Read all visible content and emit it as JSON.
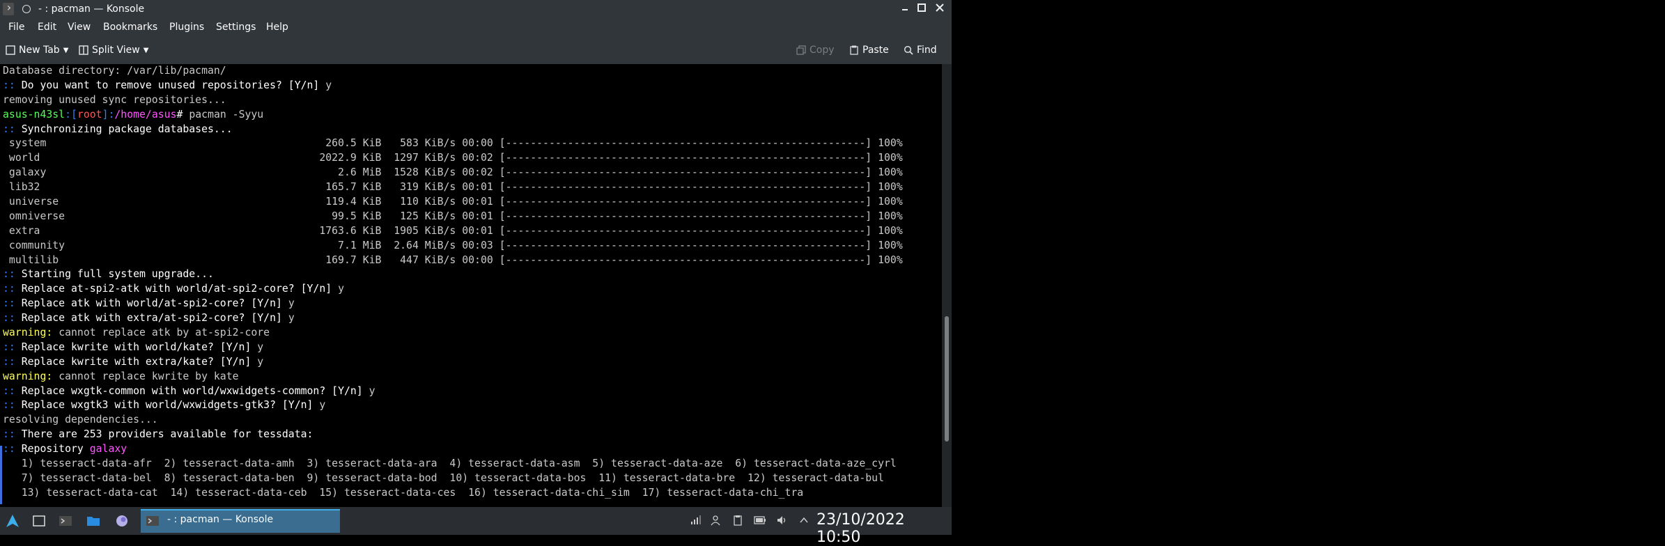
{
  "window": {
    "title": "- : pacman — Konsole",
    "controls": {
      "minimize": "minimize",
      "maximize": "maximize",
      "close": "close"
    }
  },
  "menu": [
    "File",
    "Edit",
    "View",
    "Bookmarks",
    "Plugins",
    "Settings",
    "Help"
  ],
  "toolbar": {
    "new_tab": "New Tab",
    "split_view": "Split View",
    "copy": "Copy",
    "paste": "Paste",
    "find": "Find"
  },
  "terminal": {
    "lines": [
      [
        {
          "t": "Database directory: /var/lib/pacman/",
          "c": "c-grey"
        }
      ],
      [
        {
          "t": ":: ",
          "c": "c-blue"
        },
        {
          "t": "Do you want to remove unused repositories? [Y/n] ",
          "c": "c-white"
        },
        {
          "t": "y",
          "c": "c-grey"
        }
      ],
      [
        {
          "t": "removing unused sync repositories...",
          "c": "c-grey"
        }
      ],
      [
        {
          "t": "asus-n43sl",
          "c": "c-green"
        },
        {
          "t": ":[",
          "c": "c-blue"
        },
        {
          "t": "root",
          "c": "c-red"
        },
        {
          "t": "]:",
          "c": "c-blue"
        },
        {
          "t": "/home/asus",
          "c": "c-mag"
        },
        {
          "t": "# ",
          "c": "c-white"
        },
        {
          "t": "pacman -Syyu",
          "c": "c-grey"
        }
      ],
      [
        {
          "t": ":: ",
          "c": "c-blue"
        },
        {
          "t": "Synchronizing package databases...",
          "c": "c-white"
        }
      ],
      [
        {
          "t": " system                                             260.5 KiB   583 KiB/s 00:00 [----------------------------------------------------------] 100%",
          "c": "c-grey"
        }
      ],
      [
        {
          "t": " world                                             2022.9 KiB  1297 KiB/s 00:02 [----------------------------------------------------------] 100%",
          "c": "c-grey"
        }
      ],
      [
        {
          "t": " galaxy                                               2.6 MiB  1528 KiB/s 00:02 [----------------------------------------------------------] 100%",
          "c": "c-grey"
        }
      ],
      [
        {
          "t": " lib32                                              165.7 KiB   319 KiB/s 00:01 [----------------------------------------------------------] 100%",
          "c": "c-grey"
        }
      ],
      [
        {
          "t": " universe                                           119.4 KiB   110 KiB/s 00:01 [----------------------------------------------------------] 100%",
          "c": "c-grey"
        }
      ],
      [
        {
          "t": " omniverse                                           99.5 KiB   125 KiB/s 00:01 [----------------------------------------------------------] 100%",
          "c": "c-grey"
        }
      ],
      [
        {
          "t": " extra                                             1763.6 KiB  1905 KiB/s 00:01 [----------------------------------------------------------] 100%",
          "c": "c-grey"
        }
      ],
      [
        {
          "t": " community                                            7.1 MiB  2.64 MiB/s 00:03 [----------------------------------------------------------] 100%",
          "c": "c-grey"
        }
      ],
      [
        {
          "t": " multilib                                           169.7 KiB   447 KiB/s 00:00 [----------------------------------------------------------] 100%",
          "c": "c-grey"
        }
      ],
      [
        {
          "t": ":: ",
          "c": "c-blue"
        },
        {
          "t": "Starting full system upgrade...",
          "c": "c-white"
        }
      ],
      [
        {
          "t": ":: ",
          "c": "c-blue"
        },
        {
          "t": "Replace at-spi2-atk with world/at-spi2-core? [Y/n] ",
          "c": "c-white"
        },
        {
          "t": "y",
          "c": "c-grey"
        }
      ],
      [
        {
          "t": ":: ",
          "c": "c-blue"
        },
        {
          "t": "Replace atk with world/at-spi2-core? [Y/n] ",
          "c": "c-white"
        },
        {
          "t": "y",
          "c": "c-grey"
        }
      ],
      [
        {
          "t": ":: ",
          "c": "c-blue"
        },
        {
          "t": "Replace atk with extra/at-spi2-core? [Y/n] ",
          "c": "c-white"
        },
        {
          "t": "y",
          "c": "c-grey"
        }
      ],
      [
        {
          "t": "warning: ",
          "c": "c-yellow"
        },
        {
          "t": "cannot replace atk by at-spi2-core",
          "c": "c-grey"
        }
      ],
      [
        {
          "t": ":: ",
          "c": "c-blue"
        },
        {
          "t": "Replace kwrite with world/kate? [Y/n] ",
          "c": "c-white"
        },
        {
          "t": "y",
          "c": "c-grey"
        }
      ],
      [
        {
          "t": ":: ",
          "c": "c-blue"
        },
        {
          "t": "Replace kwrite with extra/kate? [Y/n] ",
          "c": "c-white"
        },
        {
          "t": "y",
          "c": "c-grey"
        }
      ],
      [
        {
          "t": "warning: ",
          "c": "c-yellow"
        },
        {
          "t": "cannot replace kwrite by kate",
          "c": "c-grey"
        }
      ],
      [
        {
          "t": ":: ",
          "c": "c-blue"
        },
        {
          "t": "Replace wxgtk-common with world/wxwidgets-common? [Y/n] ",
          "c": "c-white"
        },
        {
          "t": "y",
          "c": "c-grey"
        }
      ],
      [
        {
          "t": ":: ",
          "c": "c-blue"
        },
        {
          "t": "Replace wxgtk3 with world/wxwidgets-gtk3? [Y/n] ",
          "c": "c-white"
        },
        {
          "t": "y",
          "c": "c-grey"
        }
      ],
      [
        {
          "t": "resolving dependencies...",
          "c": "c-grey"
        }
      ],
      [
        {
          "t": ":: ",
          "c": "c-blue"
        },
        {
          "t": "There are 253 providers available for tessdata:",
          "c": "c-white"
        }
      ],
      [
        {
          "t": ":: ",
          "c": "c-blue"
        },
        {
          "t": "Repository ",
          "c": "c-white"
        },
        {
          "t": "galaxy",
          "c": "c-mag"
        }
      ],
      [
        {
          "t": "   1) tesseract-data-afr  2) tesseract-data-amh  3) tesseract-data-ara  4) tesseract-data-asm  5) tesseract-data-aze  6) tesseract-data-aze_cyrl",
          "c": "c-grey"
        }
      ],
      [
        {
          "t": "   7) tesseract-data-bel  8) tesseract-data-ben  9) tesseract-data-bod  10) tesseract-data-bos  11) tesseract-data-bre  12) tesseract-data-bul",
          "c": "c-grey"
        }
      ],
      [
        {
          "t": "   13) tesseract-data-cat  14) tesseract-data-ceb  15) tesseract-data-ces  16) tesseract-data-chi_sim  17) tesseract-data-chi_tra",
          "c": "c-grey"
        }
      ]
    ]
  },
  "taskbar": {
    "task_label": "- : pacman — Konsole",
    "clock": "23/10/2022 10:50"
  }
}
